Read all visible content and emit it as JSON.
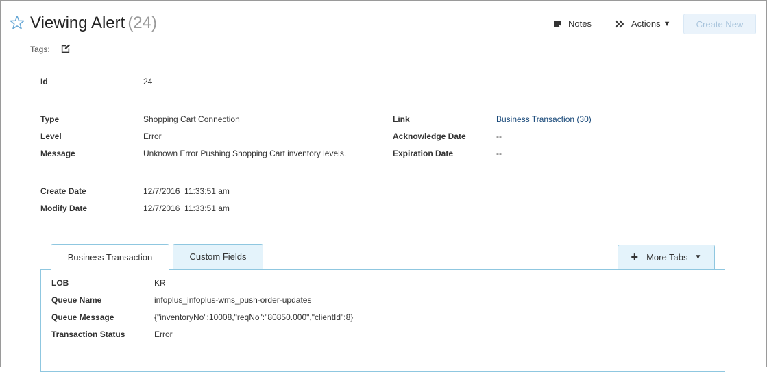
{
  "header": {
    "title": "Viewing Alert",
    "count": "(24)",
    "tags_label": "Tags:",
    "notes_label": "Notes",
    "actions_label": "Actions",
    "create_new_label": "Create New"
  },
  "fields": {
    "id": {
      "label": "Id",
      "value": "24"
    },
    "type": {
      "label": "Type",
      "value": "Shopping Cart Connection"
    },
    "level": {
      "label": "Level",
      "value": "Error"
    },
    "message": {
      "label": "Message",
      "value": "Unknown Error Pushing Shopping Cart inventory levels."
    },
    "link": {
      "label": "Link",
      "value": "Business Transaction (30)"
    },
    "acknowledge_date": {
      "label": "Acknowledge Date",
      "value": "--"
    },
    "expiration_date": {
      "label": "Expiration Date",
      "value": "--"
    },
    "create_date": {
      "label": "Create Date",
      "value": "12/7/2016  11:33:51 am"
    },
    "modify_date": {
      "label": "Modify Date",
      "value": "12/7/2016  11:33:51 am"
    }
  },
  "tabs": {
    "active": "Business Transaction",
    "inactive": "Custom Fields",
    "more": "More Tabs"
  },
  "panel": {
    "lob": {
      "label": "LOB",
      "value": "KR"
    },
    "queue_name": {
      "label": "Queue Name",
      "value": "infoplus_infoplus-wms_push-order-updates"
    },
    "queue_message": {
      "label": "Queue Message",
      "value": "{\"inventoryNo\":10008,\"reqNo\":\"80850.000\",\"clientId\":8}"
    },
    "transaction_status": {
      "label": "Transaction Status",
      "value": "Error"
    }
  },
  "colors": {
    "accent": "#6aa9d6",
    "link": "#1a4a7a",
    "tab_border": "#8fc7e0",
    "tab_bg": "#e4f3fb"
  },
  "icons": [
    "star-icon",
    "edit-icon",
    "notes-icon",
    "double-chevron-icon",
    "caret-down-icon",
    "plus-icon"
  ]
}
